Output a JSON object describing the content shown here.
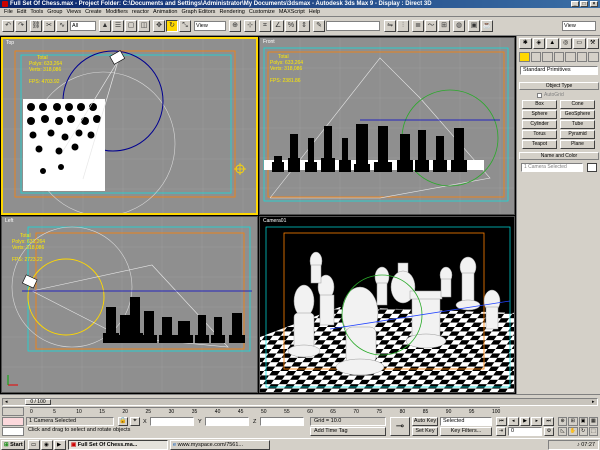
{
  "window": {
    "title": "Full Set Of Chess.max - Project Folder: C:\\Documents and Settings\\Administrator\\My Documents\\3dsmax - Autodesk 3ds Max 9 - Display : Direct 3D",
    "min_glyph": "_",
    "max_glyph": "□",
    "close_glyph": "×"
  },
  "menu": [
    "File",
    "Edit",
    "Tools",
    "Group",
    "Views",
    "Create",
    "Modifiers",
    "reactor",
    "Animation",
    "Graph Editors",
    "Rendering",
    "Customize",
    "MAXScript",
    "Help"
  ],
  "toolbar": {
    "selection_filter": "All",
    "ref_coord": "View",
    "named_sel": "",
    "view_right": "View"
  },
  "viewports": {
    "top": {
      "label": "Top",
      "total": "Total",
      "polys": "Polys: 633,264",
      "verts": "Verts: 318,086",
      "fps": "FPS: 4703.92"
    },
    "front": {
      "label": "Front",
      "total": "Total",
      "polys": "Polys: 633,264",
      "verts": "Verts: 318,086",
      "fps": "FPS: 2381.86"
    },
    "left": {
      "label": "Left",
      "total": "Total",
      "polys": "Polys: 633,264",
      "verts": "Verts: 318,086",
      "fps": "FPS: 2723.22"
    },
    "camera": {
      "label": "Camera01"
    }
  },
  "command_panel": {
    "tabs": [
      "✱",
      "◈",
      "▲",
      "◎",
      "▭",
      "⚒"
    ],
    "dropdown": "Standard Primitives",
    "object_type_header": "Object Type",
    "autogrid": "AutoGrid",
    "buttons": [
      "Box",
      "Cone",
      "Sphere",
      "GeoSphere",
      "Cylinder",
      "Tube",
      "Torus",
      "Pyramid",
      "Teapot",
      "Plane"
    ],
    "name_color_header": "Name and Color",
    "name_value": "1 Camera Selected"
  },
  "timeline": {
    "frame_indicator": "0 / 100",
    "ticks": [
      "0",
      "5",
      "10",
      "15",
      "20",
      "25",
      "30",
      "35",
      "40",
      "45",
      "50",
      "55",
      "60",
      "65",
      "70",
      "75",
      "80",
      "85",
      "90",
      "95",
      "100"
    ],
    "status_selected": "1 Camera Selected",
    "prompt": "Click and drag to select and rotate objects",
    "x_label": "X",
    "y_label": "Y",
    "z_label": "Z",
    "grid": "Grid = 10.0",
    "add_time_tag": "Add Time Tag",
    "auto_key": "Auto Key",
    "set_key": "Set Key",
    "selected_dropdown": "Selected",
    "key_filters": "Key Filters...",
    "frame_value": "0"
  },
  "taskbar": {
    "start": "Start",
    "task_max": "Full Set Of Chess.ma...",
    "task_browser": "www.myspace.com/7561...",
    "clock": "07:27"
  },
  "colors": {
    "title_bg": "#0a246a",
    "viewport_bg": "#8f8f8f",
    "active_border": "#ffd800",
    "stats_text": "#ffea00",
    "camera_bg": "#000000"
  }
}
